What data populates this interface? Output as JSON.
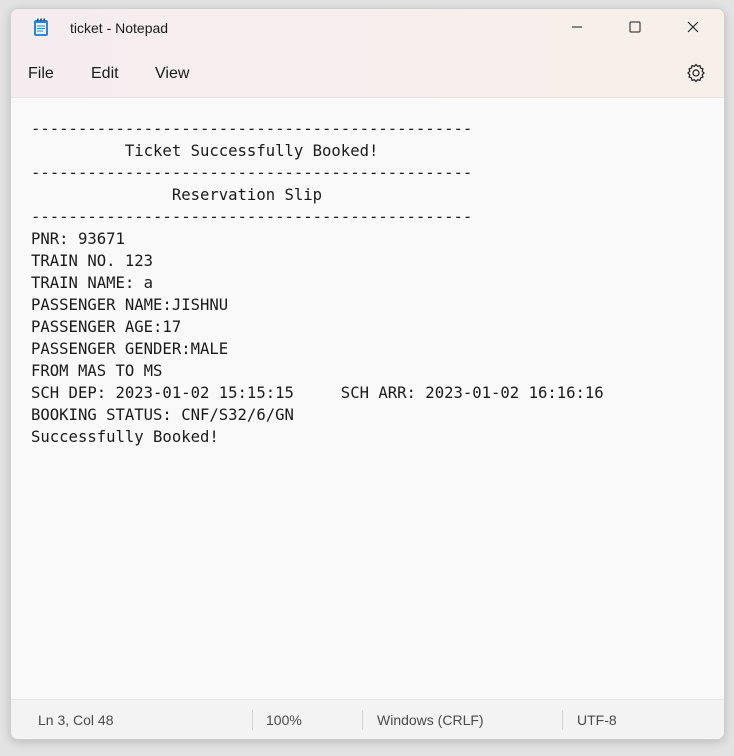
{
  "window": {
    "title": "ticket - Notepad"
  },
  "menu": {
    "file": "File",
    "edit": "Edit",
    "view": "View"
  },
  "icons": {
    "app": "notepad-icon",
    "minimize": "minimize-icon",
    "maximize": "maximize-icon",
    "close": "close-icon",
    "settings": "gear-icon"
  },
  "document": {
    "text": "-----------------------------------------------\n          Ticket Successfully Booked!\n-----------------------------------------------\n               Reservation Slip\n-----------------------------------------------\nPNR: 93671\nTRAIN NO. 123\nTRAIN NAME: a\nPASSENGER NAME:JISHNU\nPASSENGER AGE:17\nPASSENGER GENDER:MALE\nFROM MAS TO MS\nSCH DEP: 2023-01-02 15:15:15     SCH ARR: 2023-01-02 16:16:16\nBOOKING STATUS: CNF/S32/6/GN\nSuccessfully Booked!"
  },
  "status": {
    "position": "Ln 3, Col 48",
    "zoom": "100%",
    "line_endings": "Windows (CRLF)",
    "encoding": "UTF-8"
  },
  "colors": {
    "accent": "#2f6fb6",
    "text": "#1b1b1b"
  }
}
